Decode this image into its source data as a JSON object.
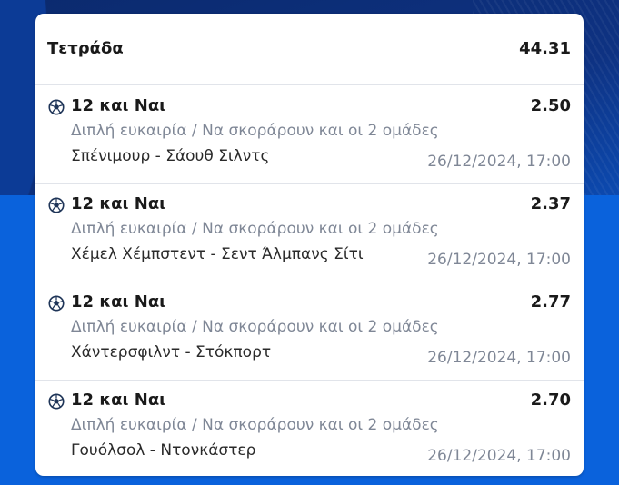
{
  "header": {
    "title": "Τετράδα",
    "total_odds": "44.31"
  },
  "colors": {
    "background_dark": "#0e3282",
    "background_blue": "#0a62dc",
    "card": "#ffffff",
    "text_primary": "#1a1a1a",
    "text_secondary": "#7f8796"
  },
  "selections": [
    {
      "icon": "soccer-ball-icon",
      "pick": "12 και Ναι",
      "odds": "2.50",
      "market": "Διπλή ευκαιρία / Να σκοράρουν και οι 2 ομάδες",
      "match": "Σπένιμουρ - Σάουθ Σιλντς",
      "datetime": "26/12/2024, 17:00"
    },
    {
      "icon": "soccer-ball-icon",
      "pick": "12 και Ναι",
      "odds": "2.37",
      "market": "Διπλή ευκαιρία / Να σκοράρουν και οι 2 ομάδες",
      "match": "Χέμελ Χέμπστεντ - Σεντ Άλμπανς Σίτι",
      "datetime": "26/12/2024, 17:00"
    },
    {
      "icon": "soccer-ball-icon",
      "pick": "12 και Ναι",
      "odds": "2.77",
      "market": "Διπλή ευκαιρία / Να σκοράρουν και οι 2 ομάδες",
      "match": "Χάντερσφιλντ - Στόκπορτ",
      "datetime": "26/12/2024, 17:00"
    },
    {
      "icon": "soccer-ball-icon",
      "pick": "12 και Ναι",
      "odds": "2.70",
      "market": "Διπλή ευκαιρία / Να σκοράρουν και οι 2 ομάδες",
      "match": "Γουόλσολ - Ντονκάστερ",
      "datetime": "26/12/2024, 17:00"
    }
  ]
}
